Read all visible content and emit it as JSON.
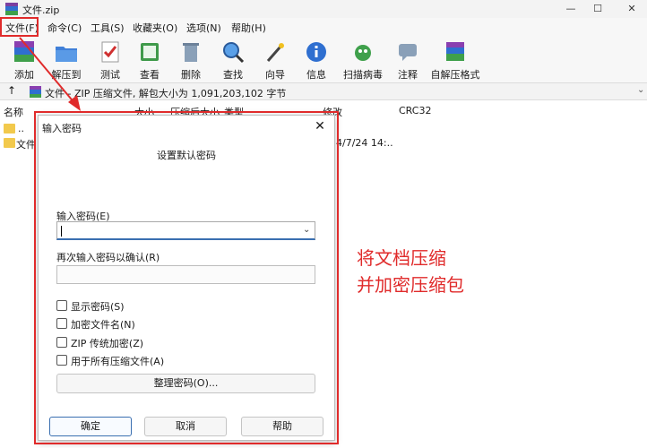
{
  "window": {
    "title": "文件.zip",
    "controls": [
      "—",
      "☐",
      "✕"
    ]
  },
  "menu": [
    "文件(F)",
    "命令(C)",
    "工具(S)",
    "收藏夹(O)",
    "选项(N)",
    "帮助(H)"
  ],
  "toolbar": [
    {
      "label": "添加",
      "icon": "add-archive-icon"
    },
    {
      "label": "解压到",
      "icon": "extract-to-icon"
    },
    {
      "label": "测试",
      "icon": "test-icon"
    },
    {
      "label": "查看",
      "icon": "view-book-icon"
    },
    {
      "label": "删除",
      "icon": "trash-icon"
    },
    {
      "label": "查找",
      "icon": "search-icon"
    },
    {
      "label": "向导",
      "icon": "wizard-icon"
    },
    {
      "label": "信息",
      "icon": "info-icon"
    },
    {
      "label": "扫描病毒",
      "icon": "virus-scan-icon"
    },
    {
      "label": "注释",
      "icon": "comment-icon"
    },
    {
      "label": "自解压格式",
      "icon": "sfx-icon"
    }
  ],
  "pathbar": {
    "text": "文件 - ZIP 压缩文件, 解包大小为 1,091,203,102 字节"
  },
  "list": {
    "columns": [
      "名称",
      "大小",
      "压缩后大小",
      "类型",
      "修改",
      "CRC32"
    ],
    "rows": [
      {
        "name": "..",
        "modified": ""
      },
      {
        "name": "文件",
        "modified": "24/7/24 14:.."
      }
    ]
  },
  "dialog": {
    "title": "输入密码",
    "heading": "设置默认密码",
    "password_label": "输入密码(E)",
    "password_value": "",
    "confirm_label": "再次输入密码以确认(R)",
    "confirm_value": "",
    "checkboxes": [
      {
        "label": "显示密码(S)",
        "checked": false
      },
      {
        "label": "加密文件名(N)",
        "checked": false
      },
      {
        "label": "ZIP 传统加密(Z)",
        "checked": false
      },
      {
        "label": "用于所有压缩文件(A)",
        "checked": false
      }
    ],
    "organize_button": "整理密码(O)...",
    "ok_button": "确定",
    "cancel_button": "取消",
    "help_button": "帮助"
  },
  "annotation": {
    "line1": "将文档压缩",
    "line2": "并加密压缩包",
    "color": "#e02b2b"
  }
}
